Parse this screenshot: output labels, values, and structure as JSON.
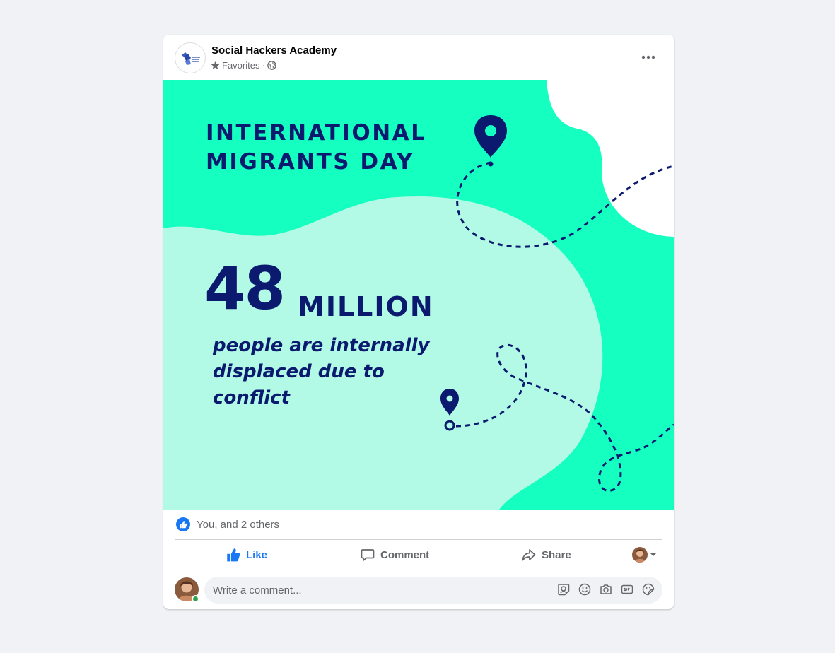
{
  "post": {
    "page_name": "Social Hackers Academy",
    "audience_label": "Favorites",
    "separator": "·",
    "logo_text": "social hackers academy"
  },
  "image": {
    "headline_line1": "INTERNATIONAL",
    "headline_line2": "MIGRANTS DAY",
    "stat_number": "48",
    "stat_unit": "MILLION",
    "caption_line1": "people are internally",
    "caption_line2": "displaced due to",
    "caption_line3": "conflict",
    "colors": {
      "mint": "#14ffc0",
      "pale_mint": "#b2fae6",
      "navy": "#0b1a6e"
    }
  },
  "reactions": {
    "text": "You, and 2 others",
    "icon": "like-reaction-icon"
  },
  "actions": {
    "like": "Like",
    "comment": "Comment",
    "share": "Share"
  },
  "comment_box": {
    "placeholder": "Write a comment...",
    "tools": [
      "avatar-sticker-icon",
      "emoji-icon",
      "camera-icon",
      "gif-icon",
      "sticker-icon"
    ]
  },
  "theme": {
    "accent": "#1877f2",
    "secondary_text": "#65676b",
    "online": "#31a24c"
  }
}
